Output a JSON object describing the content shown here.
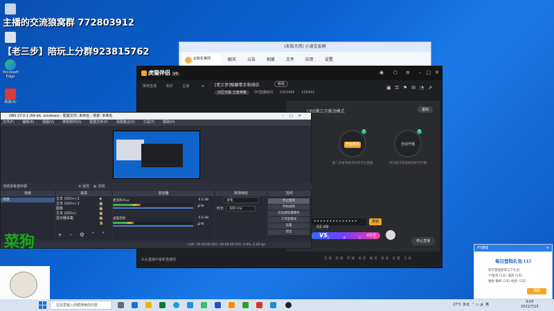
{
  "overlay": {
    "line1": "主播的交流狼窝群 772803912",
    "line2": "【老三步】陪玩上分群923815762",
    "cai_gou": "菜狗"
  },
  "desktop_icons": [
    {
      "label": "Microsoft Edge"
    },
    {
      "label": "网易UU"
    }
  ],
  "chat_window": {
    "title": "(未知大司) 小波交友群",
    "contact": "云和东某网",
    "menu": [
      "聊天",
      "公告",
      "相册",
      "文件",
      "应用",
      "设置"
    ]
  },
  "stream_app": {
    "logo": "虎猫伴侣",
    "version": "V4",
    "nav": [
      "推荐直播",
      "我的",
      "主播"
    ],
    "title": "[老三步]陪聊带王和排位",
    "edit_label": "修改",
    "tag": "分区无敌·王者荣耀",
    "room_id": "DY直播房间",
    "fans": "2053485",
    "viewers": "158441",
    "panel_title": "OBS第三方推流模式",
    "exit_label": "退出",
    "steps": [
      {
        "num": "1",
        "btn": "",
        "caption": ""
      },
      {
        "num": "2",
        "btn": "开始推流",
        "caption": "第二步复制推流码并开启直播"
      },
      {
        "num": "3",
        "btn": "自动开播",
        "caption": "开启推流和直播后即可开播"
      }
    ],
    "stream_key": "••••••••••••••",
    "copy_label": "复制",
    "pk_time": "02:49",
    "pk_vs": "VS",
    "pk_right": "0次方",
    "start_live": "停止直播",
    "chat_hint": "头头直播中最新直播现",
    "bottom_strip": "王者 直播 开播 语音 推流 更多 设置 工具"
  },
  "obs": {
    "title": "OBS 27.0.1 (64-bit, windows) - 配置文件: 未命名 - 场景: 未命名",
    "menu": [
      "文件(F)",
      "编辑(E)",
      "视图(V)",
      "停靠部件(D)",
      "配置文件(P)",
      "场景集合(S)",
      "工具(T)",
      "帮助(H)"
    ],
    "no_source": "当前没有选中源",
    "props_label": "属性",
    "filters_label": "滤镜",
    "dock_headers": [
      "场景",
      "来源",
      "混音器",
      "转场特效",
      "控件"
    ],
    "scenes": [
      "场景"
    ],
    "sources": [
      "文本 (GDI+) 2",
      "文本 (GDI+) 3",
      "图像",
      "文本 (GDI+)",
      "显示器采集"
    ],
    "mixer": [
      {
        "name": "麦克风/Aux",
        "db": "0.0 dB"
      },
      {
        "name": "桌面音频",
        "db": "0.0 dB"
      }
    ],
    "transition": {
      "label": "淡化",
      "duration_label": "时长",
      "duration": "300 ms"
    },
    "controls": [
      "停止推流",
      "开始录制",
      "启动虚拟摄像机",
      "工作室模式",
      "设置",
      "退出"
    ],
    "status": "LIVE: 00:00:00   REC: 00:00:00   CPU: 0.9%, 0.00 fps"
  },
  "notification": {
    "header": "YY游戏",
    "title": "每日登陆礼包 (1)",
    "lines": [
      "您在登陆获得以下礼包:",
      "YY金币 (1天)   道具 (1天)",
      "银色 徽章 (1天)  经验 (1天)"
    ],
    "go_label": "领取"
  },
  "taskbar": {
    "search_placeholder": "在这里输入你要搜索的内容",
    "weather": "27°C 多云",
    "lang": "英",
    "time": "9:04",
    "date": "2021/7/15"
  }
}
